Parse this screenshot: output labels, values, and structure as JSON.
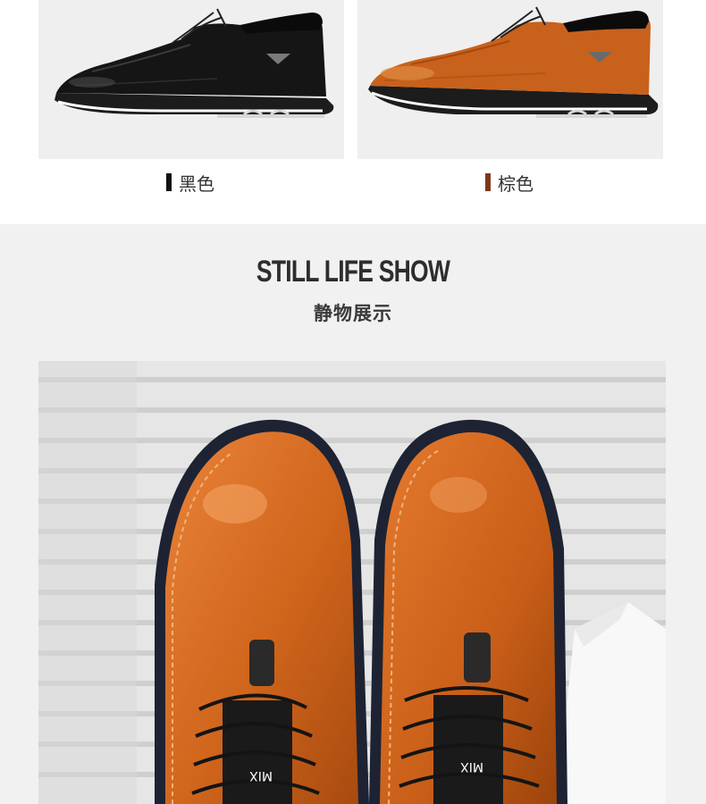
{
  "variants": [
    {
      "label": "黑色",
      "swatch_color": "#111111",
      "shoe_color": "#1a1a1a"
    },
    {
      "label": "棕色",
      "swatch_color": "#7a3a14",
      "shoe_color": "#c8611c"
    }
  ],
  "section": {
    "title": "STILL LIFE SHOW",
    "subtitle": "静物展示"
  },
  "photo": {
    "tag_text": "MIX",
    "leather_color": "#d26a1e",
    "blind_color": "#e4e4e4"
  }
}
